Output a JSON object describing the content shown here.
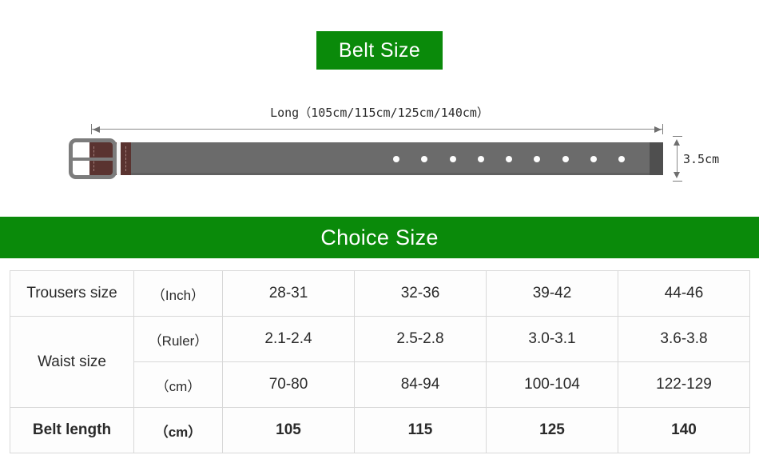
{
  "banners": {
    "belt_size": "Belt Size",
    "choice_size": "Choice Size",
    "green": "#0a8a0a"
  },
  "diagram": {
    "length_caption": "Long（105cm/115cm/125cm/140cm）",
    "width_label": "3.5cm",
    "hole_count": 9,
    "strap_color": "#6b6b6b",
    "leather_color": "#5a3330",
    "buckle_color": "#7c7c7c"
  },
  "table": {
    "rows": [
      {
        "label": "Trousers size",
        "unit": "（Inch）",
        "values": [
          "28-31",
          "32-36",
          "39-42",
          "44-46"
        ],
        "bold": false
      },
      {
        "label": "Waist size",
        "unit": "（Ruler）",
        "values": [
          "2.1-2.4",
          "2.5-2.8",
          "3.0-3.1",
          "3.6-3.8"
        ],
        "bold": false
      },
      {
        "label": "",
        "unit": "（cm）",
        "values": [
          "70-80",
          "84-94",
          "100-104",
          "122-129"
        ],
        "bold": false
      },
      {
        "label": "Belt length",
        "unit": "（cm）",
        "values": [
          "105",
          "115",
          "125",
          "140"
        ],
        "bold": true
      }
    ]
  }
}
